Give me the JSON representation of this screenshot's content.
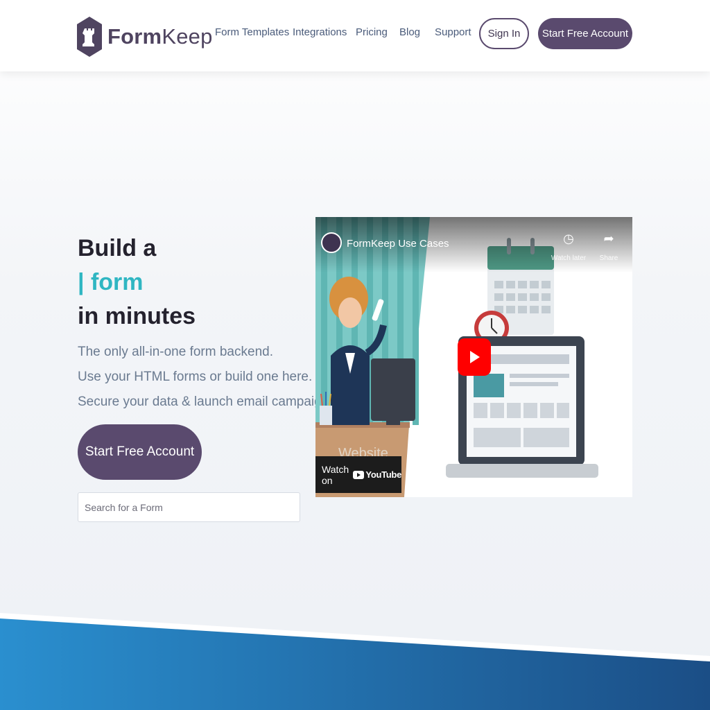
{
  "header": {
    "logo_text": "FormKeep",
    "nav": [
      {
        "label": "Form Templates"
      },
      {
        "label": "Integrations"
      },
      {
        "label": "Pricing"
      },
      {
        "label": "Blog"
      },
      {
        "label": "Support"
      }
    ],
    "signin_label": "Sign In",
    "cta_label": "Start Free Account"
  },
  "hero": {
    "title_line1": "Build a",
    "title_line2": "| form",
    "title_line3": "in minutes",
    "subtitle": [
      "The only all-in-one form backend.",
      "Use your HTML forms or build one here.",
      "Secure your data & launch email campaigns."
    ],
    "cta_label": "Start Free Account",
    "search_placeholder": "Search for a Form"
  },
  "video": {
    "title": "FormKeep Use Cases",
    "watch_later": "Watch later",
    "share": "Share",
    "watch_on": "Watch on",
    "youtube": "YouTube",
    "website_label": "Website"
  },
  "colors": {
    "brand_purple": "#5a4a6e",
    "accent_teal": "#2fb6c2",
    "nav_text": "#4a5b7a",
    "footer_blue": "#1f6fb0"
  },
  "icons": {
    "logo": "rook-shield-icon",
    "watch_later": "clock-icon",
    "share": "share-arrow-icon",
    "play": "youtube-play-icon"
  }
}
